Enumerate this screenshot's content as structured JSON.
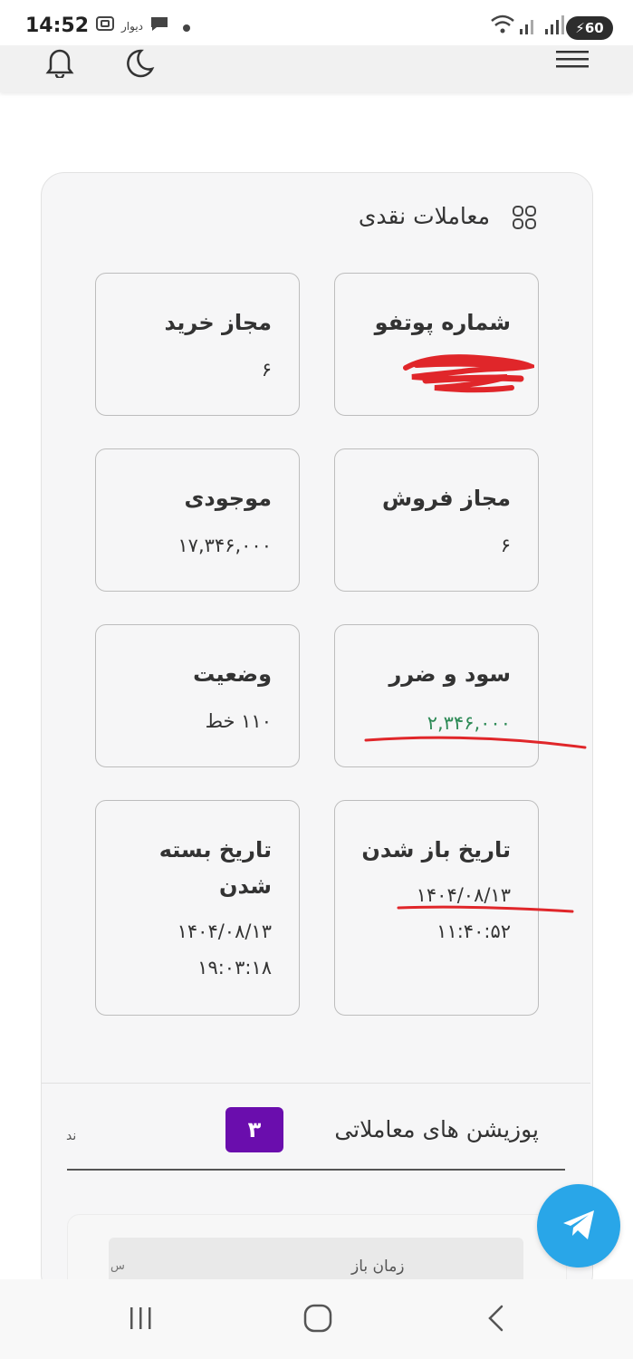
{
  "status_bar": {
    "time": "14:52",
    "app_label": "دیوار",
    "battery": "60"
  },
  "header": {
    "icons": [
      "bell-icon",
      "moon-icon",
      "menu-icon"
    ]
  },
  "cash_trades": {
    "title": "معاملات نقدی",
    "tiles": [
      {
        "label": "شماره پوتفو",
        "value": ""
      },
      {
        "label": "مجاز خرید",
        "value": "۶"
      },
      {
        "label": "مجاز فروش",
        "value": "۶"
      },
      {
        "label": "موجودی",
        "value": "۱۷,۳۴۶,۰۰۰"
      },
      {
        "label": "سود و ضرر",
        "value": "۲,۳۴۶,۰۰۰"
      },
      {
        "label": "وضعیت",
        "value": "۱۱۰ خط"
      },
      {
        "label": "تاریخ باز شدن",
        "value": "۱۴۰۴/۰۸/۱۳",
        "value2": "۱۱:۴۰:۵۲"
      },
      {
        "label_line1": "تاریخ بسته",
        "label_line2": "شدن",
        "value": "۱۴۰۴/۰۸/۱۳",
        "value2": "۱۹:۰۳:۱۸"
      }
    ]
  },
  "positions": {
    "title": "پوزیشن های معاملاتی",
    "count": "۳",
    "left_text": "ند",
    "sub_header": "زمان باز",
    "sub_left": "س"
  },
  "colors": {
    "profit_green": "#2e8b57",
    "badge_purple": "#6a0dad",
    "telegram_blue": "#29a6e8",
    "annotation_red": "#e0262a"
  }
}
